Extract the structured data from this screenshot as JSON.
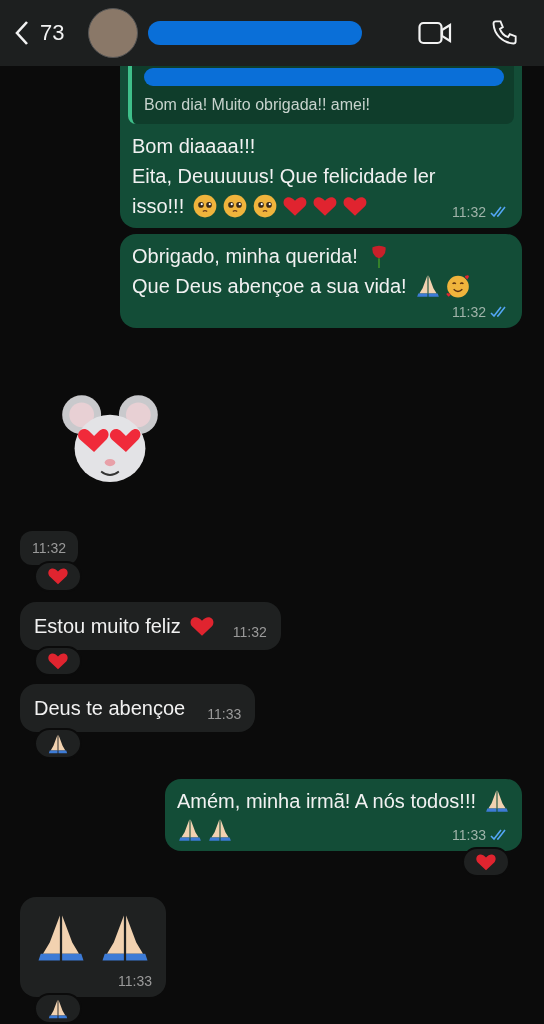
{
  "header": {
    "back_count": "73"
  },
  "messages": [
    {
      "kind": "out",
      "quote": {
        "text": "Bom dia! Muito obrigada!! amei!"
      },
      "lines": [
        [
          {
            "kind": "text",
            "text": "Bom diaaaa!!!"
          }
        ],
        [
          {
            "kind": "text",
            "text": "Eita, Deuuuuus! Que felicidade ler"
          }
        ],
        [
          {
            "kind": "text",
            "text": "isso!!!"
          },
          {
            "kind": "pleading"
          },
          {
            "kind": "pleading"
          },
          {
            "kind": "pleading"
          },
          {
            "kind": "heart"
          },
          {
            "kind": "heart"
          },
          {
            "kind": "heart"
          }
        ]
      ],
      "time": "11:32",
      "read": true
    },
    {
      "kind": "out",
      "lines": [
        [
          {
            "kind": "text",
            "text": "Obrigado, minha querida!"
          },
          {
            "kind": "rose"
          }
        ],
        [
          {
            "kind": "text",
            "text": "Que Deus abençoe a sua vida!"
          },
          {
            "kind": "pray"
          },
          {
            "kind": "hearts_face"
          }
        ]
      ],
      "time": "11:32",
      "read": true
    },
    {
      "kind": "sticker",
      "time": "11:32",
      "reaction": {
        "kind": "heart"
      }
    },
    {
      "kind": "in",
      "lines": [
        [
          {
            "kind": "text",
            "text": "Estou muito feliz"
          },
          {
            "kind": "heart"
          }
        ]
      ],
      "time": "11:32",
      "reaction": {
        "kind": "heart"
      }
    },
    {
      "kind": "in",
      "lines": [
        [
          {
            "kind": "text",
            "text": "Deus te abençoe"
          }
        ]
      ],
      "time": "11:33",
      "reaction": {
        "kind": "pray"
      }
    },
    {
      "kind": "out",
      "lines": [
        [
          {
            "kind": "text",
            "text": "Amém, minha irmã! A nós todos!!!"
          },
          {
            "kind": "pray"
          }
        ],
        [
          {
            "kind": "pray"
          },
          {
            "kind": "pray"
          }
        ]
      ],
      "time": "11:33",
      "read": true,
      "reaction": {
        "kind": "heart"
      }
    },
    {
      "kind": "big_emoji",
      "emojis": [
        {
          "kind": "pray"
        },
        {
          "kind": "pray"
        }
      ],
      "time": "11:33",
      "reaction": {
        "kind": "pray"
      }
    }
  ]
}
